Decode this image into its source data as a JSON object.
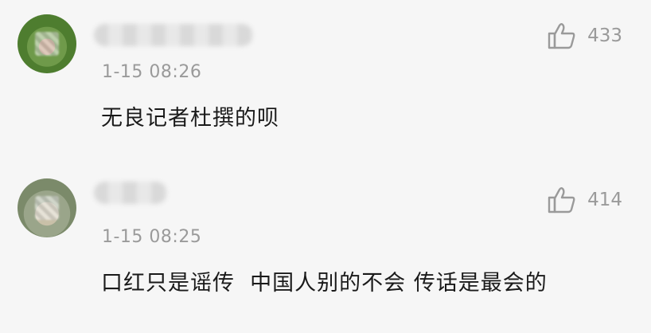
{
  "comments": [
    {
      "like_count": "433",
      "timestamp": "1-15 08:26",
      "text": "无良记者杜撰的呗"
    },
    {
      "like_count": "414",
      "timestamp": "1-15 08:25",
      "text": "口红只是谣传  中国人别的不会 传话是最会的"
    }
  ],
  "icons": {
    "like": "thumbs-up-icon"
  },
  "colors": {
    "text": "#1a1a1a",
    "meta": "#9a9a9a",
    "background": "#f6f6f6"
  }
}
